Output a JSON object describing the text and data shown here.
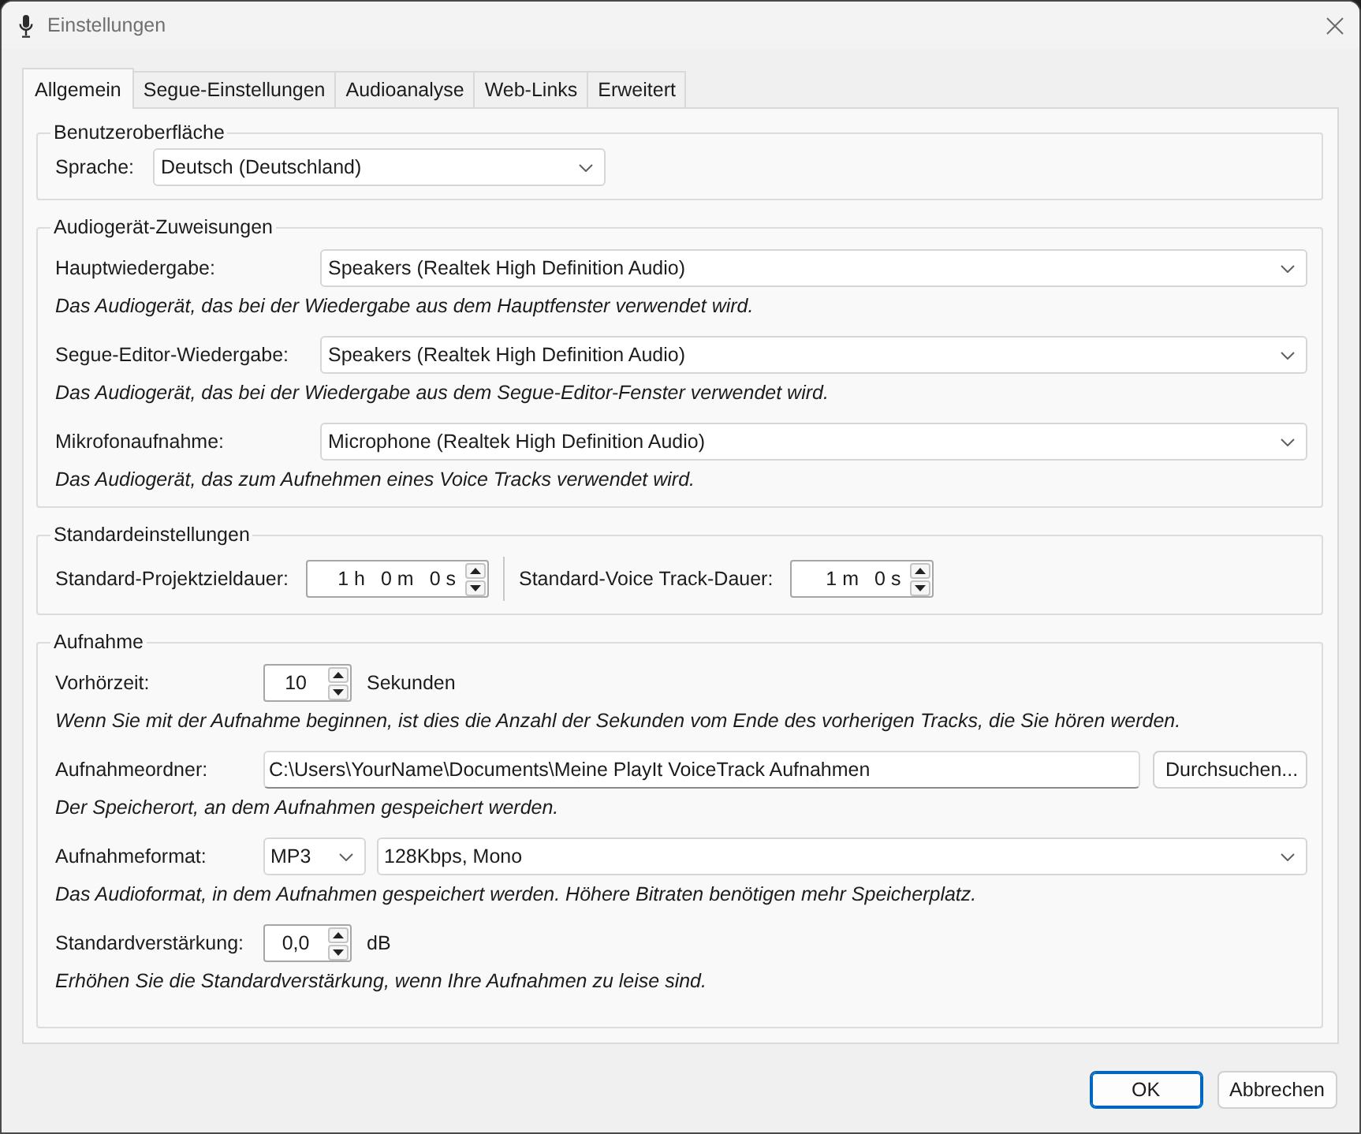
{
  "window": {
    "title": "Einstellungen"
  },
  "tabs": [
    {
      "label": "Allgemein",
      "selected": true
    },
    {
      "label": "Segue-Einstellungen",
      "selected": false
    },
    {
      "label": "Audioanalyse",
      "selected": false
    },
    {
      "label": "Web-Links",
      "selected": false
    },
    {
      "label": "Erweitert",
      "selected": false
    }
  ],
  "groups": [
    {
      "title": "Benutzeroberfläche",
      "rows": [
        {
          "kind": "select",
          "label": "Sprache:",
          "value": "Deutsch (Deutschland)"
        }
      ]
    },
    {
      "title": "Audiogerät-Zuweisungen",
      "rows": [
        {
          "kind": "select",
          "label": "Hauptwiedergabe:",
          "value": "Speakers (Realtek High Definition Audio)",
          "help": "Das Audiogerät, das bei der Wiedergabe aus dem Hauptfenster verwendet wird."
        },
        {
          "kind": "select",
          "label": "Segue-Editor-Wiedergabe:",
          "value": "Speakers (Realtek High Definition Audio)",
          "help": "Das Audiogerät, das bei der Wiedergabe aus dem Segue-Editor-Fenster verwendet wird."
        },
        {
          "kind": "select",
          "label": "Mikrofonaufnahme:",
          "value": "Microphone (Realtek High Definition Audio)",
          "help": "Das Audiogerät, das zum Aufnehmen eines Voice Tracks verwendet wird."
        }
      ]
    },
    {
      "title": "Standardeinstellungen",
      "rows": [
        {
          "kind": "durations",
          "fields": [
            {
              "label": "Standard-Projektzieldauer:",
              "parts": [
                {
                  "value": "1",
                  "unit": "h"
                },
                {
                  "value": "0",
                  "unit": "m"
                },
                {
                  "value": "0",
                  "unit": "s"
                }
              ]
            },
            {
              "label": "Standard-Voice Track-Dauer:",
              "parts": [
                {
                  "value": "1",
                  "unit": "m"
                },
                {
                  "value": "0",
                  "unit": "s"
                }
              ]
            }
          ]
        }
      ]
    },
    {
      "title": "Aufnahme",
      "rows": [
        {
          "kind": "spinner",
          "label": "Vorhörzeit:",
          "value": "10",
          "unit": "Sekunden",
          "help": "Wenn Sie mit der Aufnahme beginnen, ist dies die Anzahl der Sekunden vom Ende des vorherigen Tracks, die Sie hören werden."
        },
        {
          "kind": "folder",
          "label": "Aufnahmeordner:",
          "value": "C:\\Users\\YourName\\Documents\\Meine PlayIt VoiceTrack Aufnahmen",
          "button": "Durchsuchen...",
          "help": "Der Speicherort, an dem Aufnahmen gespeichert werden."
        },
        {
          "kind": "format",
          "label": "Aufnahmeformat:",
          "format": "MP3",
          "quality": "128Kbps, Mono",
          "help": "Das Audioformat, in dem Aufnahmen gespeichert werden. Höhere Bitraten benötigen mehr Speicherplatz."
        },
        {
          "kind": "spinner",
          "label": "Standardverstärkung:",
          "value": "0,0",
          "unit": "dB",
          "help": "Erhöhen Sie die Standardverstärkung, wenn Ihre Aufnahmen zu leise sind."
        }
      ]
    }
  ],
  "buttons": [
    {
      "label": "OK",
      "default": true
    },
    {
      "label": "Abbrechen",
      "default": false
    }
  ]
}
